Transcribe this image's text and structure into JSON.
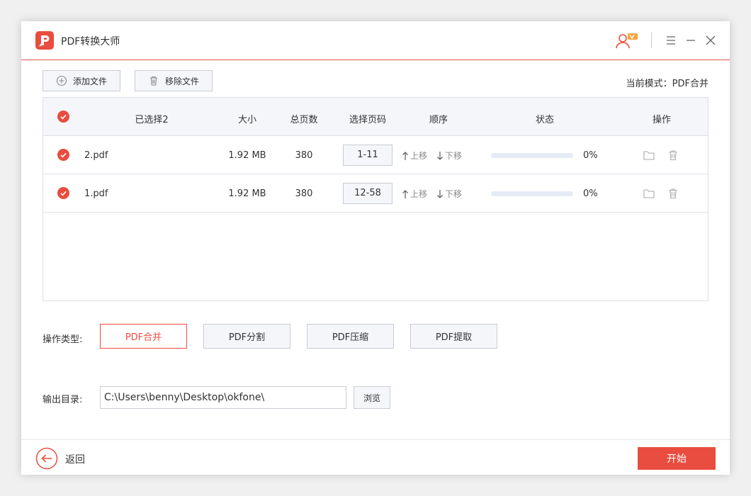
{
  "app": {
    "title": "PDF转换大师",
    "logo_letter": "P"
  },
  "toolbar": {
    "add_label": "添加文件",
    "remove_label": "移除文件",
    "mode_label": "当前模式：PDF合并"
  },
  "table": {
    "headers": {
      "selected": "已选择2",
      "size": "大小",
      "pages": "总页数",
      "page_range": "选择页码",
      "order": "顺序",
      "status": "状态",
      "actions": "操作"
    },
    "rows": [
      {
        "name": "2.pdf",
        "size": "1.92 MB",
        "pages": "380",
        "range": "1-11",
        "up": "上移",
        "down": "下移",
        "progress": "0%",
        "progress_value": 0
      },
      {
        "name": "1.pdf",
        "size": "1.92 MB",
        "pages": "380",
        "range": "12-58",
        "up": "上移",
        "down": "下移",
        "progress": "0%",
        "progress_value": 0
      }
    ]
  },
  "operation": {
    "label": "操作类型:",
    "options": [
      "PDF合并",
      "PDF分割",
      "PDF压缩",
      "PDF提取"
    ],
    "selected": "PDF合并"
  },
  "output": {
    "label": "输出目录:",
    "path": "C:\\Users\\benny\\Desktop\\okfone\\",
    "browse_label": "浏览"
  },
  "footer": {
    "back_label": "返回",
    "start_label": "开始"
  },
  "colors": {
    "accent": "#e94d3f",
    "border": "#c8ccd3",
    "panel": "#f4f6fa"
  },
  "icons": {
    "logo": "pdf-logo-icon",
    "user": "user-vip-icon",
    "menu": "menu-icon",
    "minimize": "minimize-icon",
    "close": "close-icon",
    "add": "plus-circle-icon",
    "remove": "trash-icon",
    "check": "check-circle-icon",
    "folder": "folder-icon",
    "delete": "trash-icon",
    "up": "arrow-up-icon",
    "down": "arrow-down-icon",
    "back": "back-arrow-icon"
  }
}
